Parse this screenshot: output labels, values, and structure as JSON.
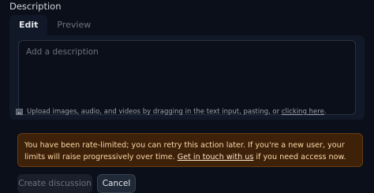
{
  "section_label": "Description",
  "tabs": [
    {
      "label": "Edit",
      "active": true
    },
    {
      "label": "Preview",
      "active": false
    }
  ],
  "editor": {
    "placeholder": "Add a description",
    "upload_text": "Upload images, audio, and videos by dragging in the text input, pasting, or",
    "upload_link": "clicking here",
    "upload_suffix": "."
  },
  "alert": {
    "text_before_link": "You have been rate-limited; you can retry this action later. If you're a new user, your limits will raise progressively over time.",
    "link": "Get in touch with us",
    "text_after_link": "if you need access now."
  },
  "buttons": {
    "create": "Create discussion",
    "cancel": "Cancel"
  },
  "colors": {
    "background": "#0b0f19",
    "panel": "#111827",
    "alert_bg": "#3d2109",
    "alert_text": "#fcd9a8"
  },
  "icons": {
    "upload": "image-icon"
  }
}
